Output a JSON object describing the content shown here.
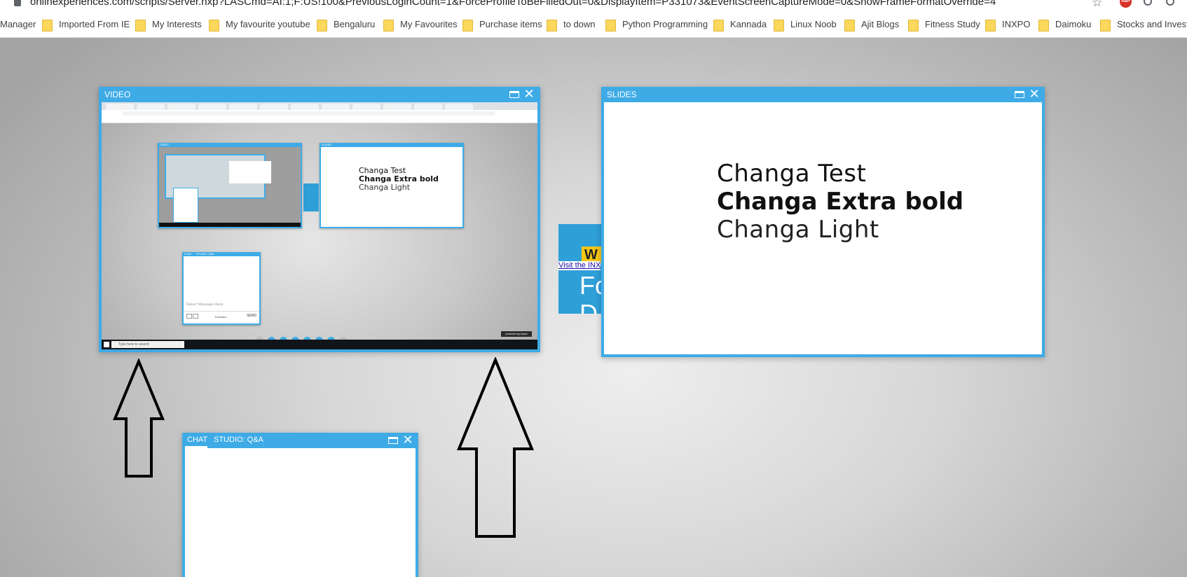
{
  "browser": {
    "url": "onlinexperiences.com/scripts/Server.nxp?LASCmd=AI:1;F:US!100&PreviousLoginCount=1&ForceProfileToBeFilledOut=0&DisplayItem=P331073&EventScreenCaptureMode=0&ShowFrameFormatOverride=4",
    "extension_badge": "ABP",
    "bookmarks": [
      "Manager",
      "Imported From IE",
      "My Interests",
      "My favourite youtube",
      "Bengaluru",
      "My Favourites",
      "Purchase items",
      "to down",
      "Python Programming",
      "Kannada",
      "Linux Noob",
      "Ajit Blogs",
      "Fitness Study",
      "INXPO",
      "Daimoku",
      "Stocks and Investm"
    ]
  },
  "video_panel": {
    "title": "VIDEO",
    "nested": {
      "slides_title": "SLIDES",
      "video_title": "VIDEO",
      "chat_title": "CHAT",
      "chat_tab2": "STUDIO: Q&A",
      "chat_placeholder": "Enter Message Here",
      "send_label": "SEND",
      "translator_label": "Translator",
      "taskbar_search": "Type here to search",
      "logo_text": "powered by inxpo",
      "slide_lines": [
        "Changa Test",
        "Changa Extra bold",
        "Changa Light"
      ]
    }
  },
  "slides_panel": {
    "title": "SLIDES",
    "lines": [
      "Changa Test",
      "Changa Extra bold",
      "Changa Light"
    ]
  },
  "promo": {
    "letter": "W",
    "link_text": "Visit the INX",
    "big_text_1": "Fo",
    "big_text_2": "D"
  },
  "chat_panel": {
    "tabs": [
      "CHAT",
      "STUDIO: Q&A"
    ]
  },
  "colors": {
    "panel_blue": "#3eabe7",
    "folder_yellow": "#fbd75b"
  }
}
